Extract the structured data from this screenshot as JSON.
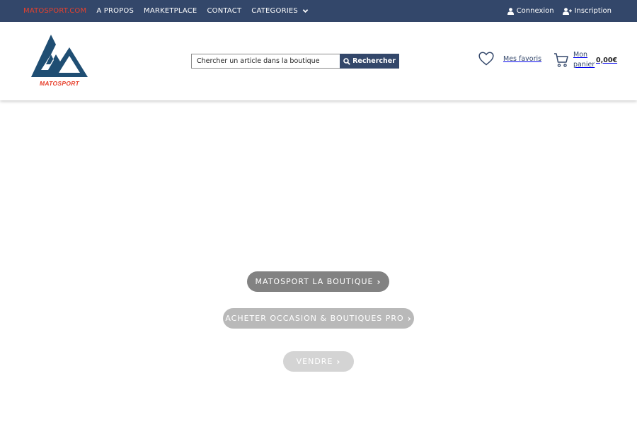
{
  "topnav": {
    "items": [
      {
        "label": "MATOSPORT.COM"
      },
      {
        "label": "A PROPOS"
      },
      {
        "label": "MARKETPLACE"
      },
      {
        "label": "CONTACT"
      },
      {
        "label": "CATEGORIES"
      }
    ],
    "login_label": "Connexion",
    "signup_label": "Inscription"
  },
  "header": {
    "logo_text": "MATOSPORT",
    "search": {
      "placeholder": "Chercher un article dans la boutique",
      "value": "",
      "button_label": "Rechercher"
    },
    "favorites_label": "Mes favoris",
    "cart": {
      "label": "Mon panier",
      "total": "0,00€"
    }
  },
  "main": {
    "buttons": [
      {
        "label": "MATOSPORT LA BOUTIQUE"
      },
      {
        "label": "ACHETER OCCASION & BOUTIQUES PRO"
      },
      {
        "label": "VENDRE"
      }
    ]
  },
  "colors": {
    "navy": "#33476a",
    "brand_red": "#e7412d",
    "pill_dark": "#828282",
    "pill_mid": "#b9b9b9",
    "pill_light": "#d4d4d4"
  },
  "icons": [
    "chevron-down-icon",
    "user-icon",
    "user-plus-icon",
    "search-icon",
    "heart-icon",
    "cart-icon",
    "chevron-right-icon"
  ]
}
